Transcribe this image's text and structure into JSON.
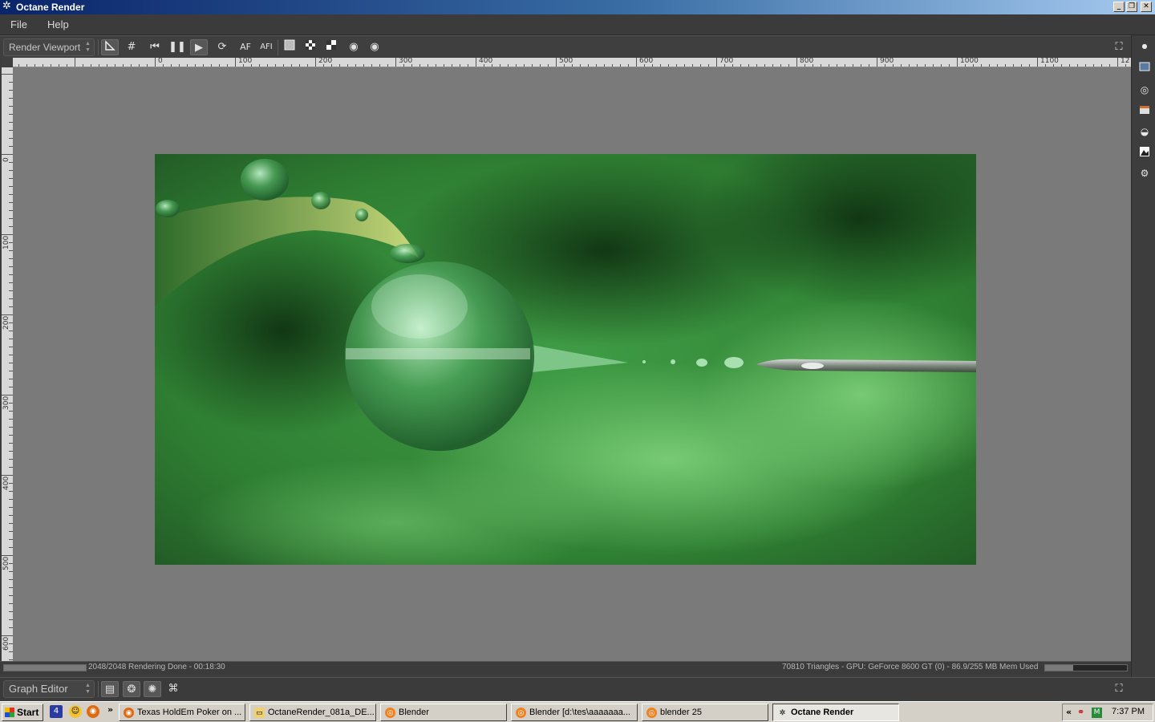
{
  "window": {
    "title": "Octane Render",
    "minimize": "_",
    "restore": "❐",
    "close": "✕"
  },
  "menu": [
    "File",
    "Help"
  ],
  "toolbar": {
    "viewport_select": "Render Viewport",
    "af_label": "AF",
    "afi_label": "AFI"
  },
  "ruler": {
    "top": [
      "0",
      "100",
      "200",
      "300",
      "400",
      "500",
      "600",
      "700",
      "800",
      "900",
      "1000",
      "1100",
      "12"
    ],
    "left": [
      "0",
      "100",
      "200",
      "300",
      "400",
      "500",
      "600"
    ]
  },
  "status": {
    "progress_fraction": 1.0,
    "left_text": "2048/2048 Rendering Done - 00:18:30",
    "right_text": "70810 Triangles - GPU: GeForce 8600 GT (0) - 86.9/255 MB Mem Used",
    "mem_fraction": 0.34
  },
  "graph": {
    "select": "Graph Editor"
  },
  "taskbar": {
    "start": "Start",
    "chevron": "»",
    "tasks": [
      "Texas HoldEm Poker on ...",
      "OctaneRender_081a_DE...",
      "Blender",
      "Blender [d:\\tes\\aaaaaaa...",
      "blender 25",
      "Octane Render"
    ],
    "tray_chevron": "«",
    "clock": "7:37 PM"
  },
  "colors": {
    "viewport_bg": "#7a7a7a",
    "ui_dark": "#3b3b3b",
    "title_start": "#0a246a",
    "title_end": "#a6caf0"
  }
}
